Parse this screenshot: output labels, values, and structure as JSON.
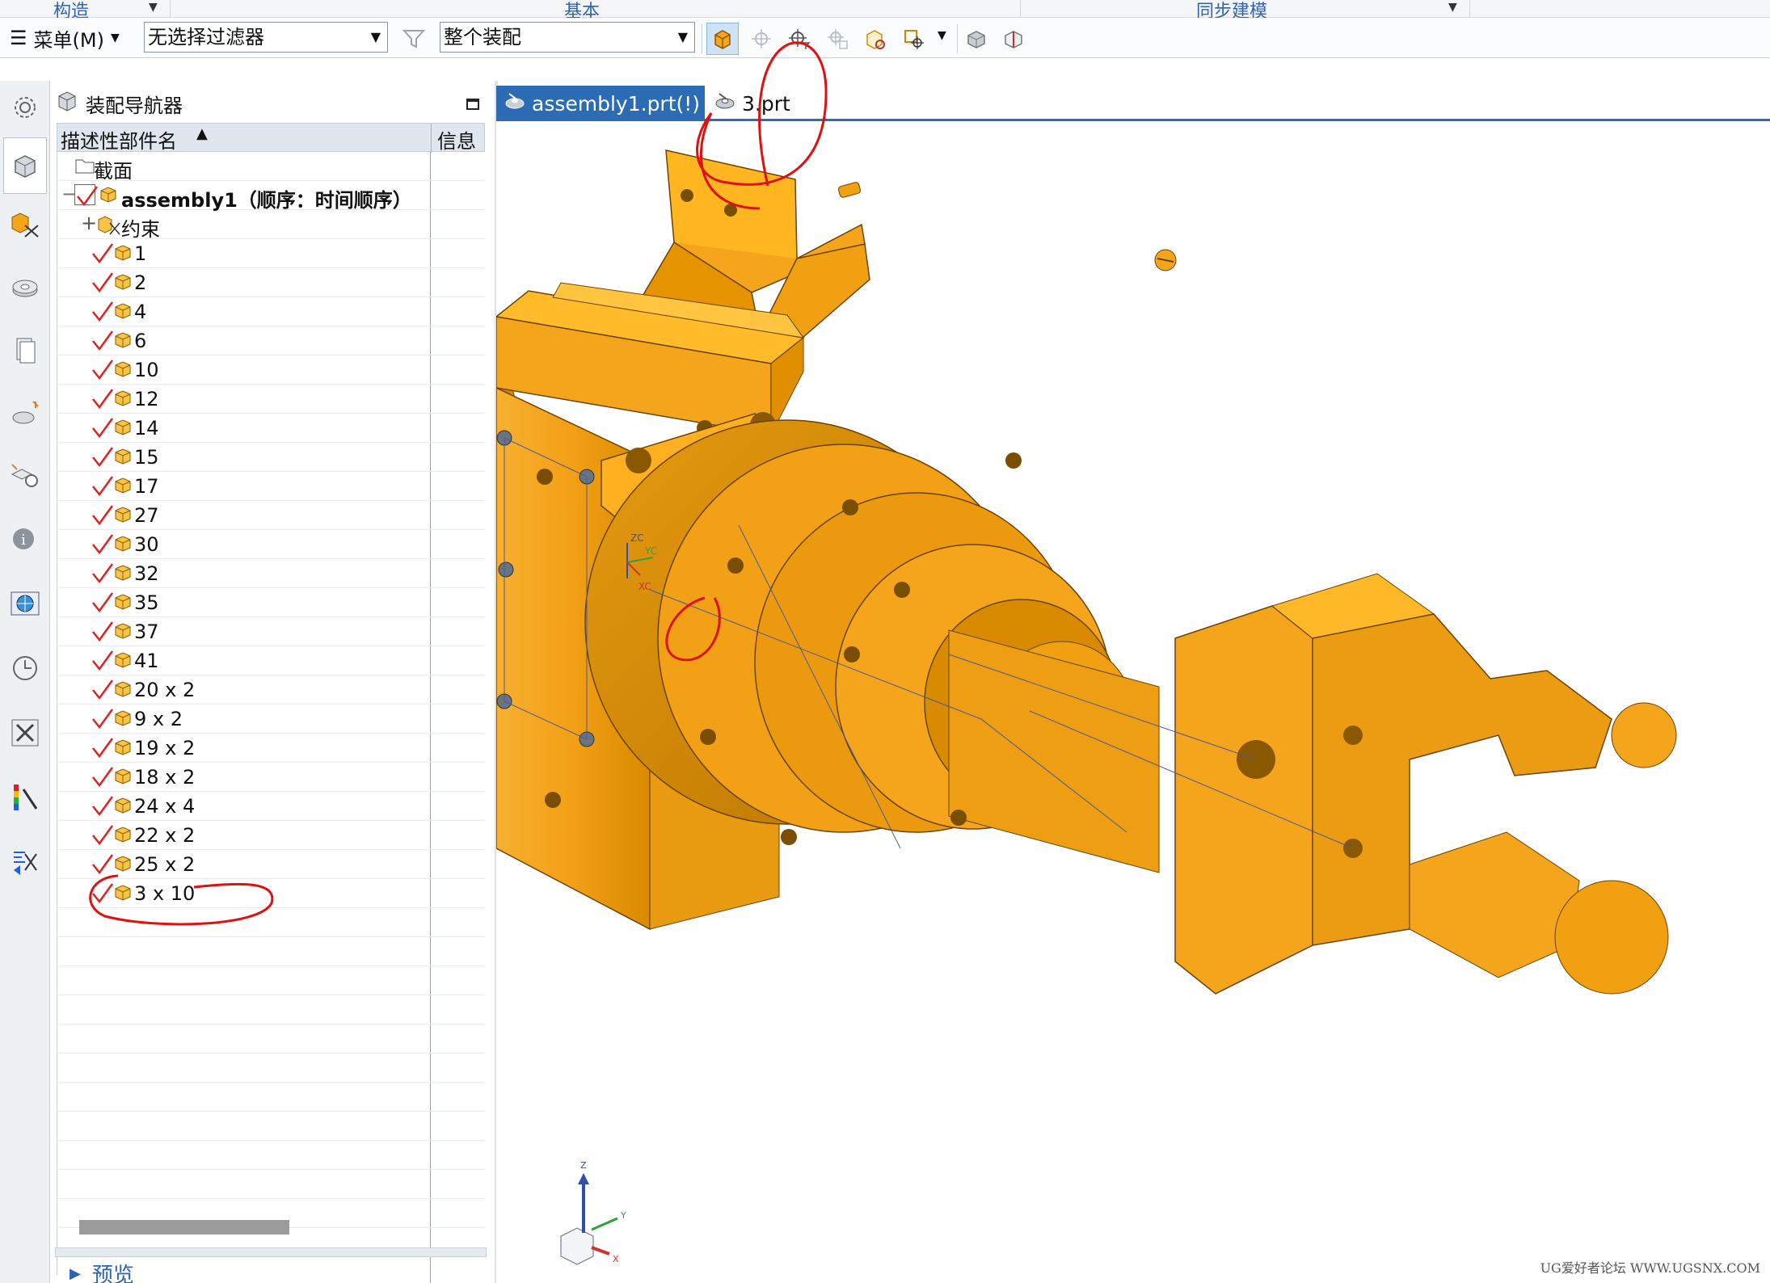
{
  "ribbon_groups": [
    {
      "label": "构造"
    },
    {
      "label": "基本"
    },
    {
      "label": "同步建模"
    }
  ],
  "toolbar": {
    "menu_label": "菜单(M)",
    "filter_value": "无选择过滤器",
    "scope_value": "整个装配"
  },
  "navigator": {
    "title": "装配导航器",
    "col_name": "描述性部件名",
    "col_info": "信息",
    "rows": [
      {
        "label": "截面",
        "type": "folder"
      },
      {
        "label": "assembly1（顺序：时间顺序）",
        "type": "root"
      },
      {
        "label": "约束",
        "type": "constraints"
      },
      {
        "label": "1"
      },
      {
        "label": "2"
      },
      {
        "label": "4"
      },
      {
        "label": "6"
      },
      {
        "label": "10"
      },
      {
        "label": "12"
      },
      {
        "label": "14"
      },
      {
        "label": "15"
      },
      {
        "label": "17"
      },
      {
        "label": "27"
      },
      {
        "label": "30"
      },
      {
        "label": "32"
      },
      {
        "label": "35"
      },
      {
        "label": "37"
      },
      {
        "label": "41"
      },
      {
        "label": "20 x 2"
      },
      {
        "label": "9 x 2"
      },
      {
        "label": "19 x 2"
      },
      {
        "label": "18 x 2"
      },
      {
        "label": "24 x 4"
      },
      {
        "label": "22 x 2"
      },
      {
        "label": "25 x 2"
      },
      {
        "label": "3 x 10"
      }
    ],
    "preview_label": "预览"
  },
  "tabs": [
    {
      "label": "assembly1.prt(!)",
      "active": true
    },
    {
      "label": "3.prt",
      "active": false
    }
  ],
  "viewport": {
    "part_color": "#f5a51c",
    "triad": {
      "z": "Z",
      "y": "Y",
      "x": "X"
    },
    "wcs": {
      "zc": "ZC",
      "yc": "YC",
      "xc": "XC"
    },
    "watermark": "UG爱好者论坛 WWW.UGSNX.COM"
  },
  "colors": {
    "accent": "#2b6cb4",
    "check": "#e02020",
    "annotation": "#e01010"
  }
}
